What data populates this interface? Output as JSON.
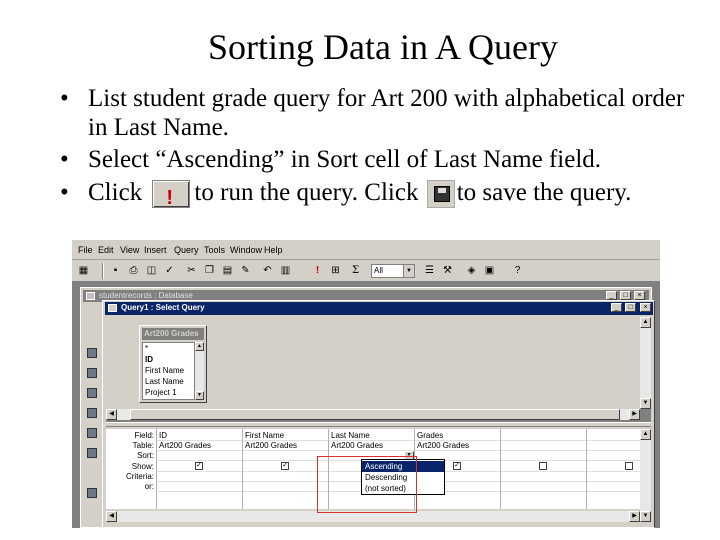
{
  "slide": {
    "title": "Sorting Data in A Query",
    "bullet1": "List student grade query for Art 200  with alphabetical order in Last Name.",
    "bullet2": "Select “Ascending” in Sort cell of Last Name field.",
    "bullet3_part1": "Click",
    "bullet3_part2": "to run the query.  Click",
    "bullet3_part3": "to save the query.",
    "run_icon_glyph": "!",
    "run_icon": "run-exclamation-icon",
    "save_icon": "floppy-disk-icon"
  },
  "menubar": {
    "items": [
      "File",
      "Edit",
      "View",
      "Insert",
      "Query",
      "Tools",
      "Window",
      "Help"
    ]
  },
  "toolbar": {
    "combo_value": "All",
    "run_glyph": "!",
    "totals_glyph": "Σ"
  },
  "db_window": {
    "title": "studentrecords : Database"
  },
  "query_window": {
    "title": "Query1 : Select Query",
    "min": "_",
    "max": "□",
    "close": "×"
  },
  "field_list": {
    "title": "Art200 Grades",
    "items": [
      "*",
      "ID",
      "First Name",
      "Last Name",
      "Project 1"
    ]
  },
  "design_grid": {
    "row_labels": [
      "Field:",
      "Table:",
      "Sort:",
      "Show:",
      "Criteria:",
      "or:"
    ],
    "columns": [
      {
        "field": "ID",
        "table": "Art200 Grades",
        "show": true
      },
      {
        "field": "First Name",
        "table": "Art200 Grades",
        "show": true
      },
      {
        "field": "Last Name",
        "table": "Art200 Grades",
        "show": true
      },
      {
        "field": "Grades",
        "table": "Art200 Grades",
        "show": true
      },
      {
        "field": "",
        "table": "",
        "show": false
      },
      {
        "field": "",
        "table": "",
        "show": false
      }
    ],
    "sort_options": [
      "Ascending",
      "Descending",
      "(not sorted)"
    ],
    "selected_sort": "Ascending",
    "check_glyph": "✓"
  },
  "colors": {
    "title_active": "#0a246a",
    "title_inactive": "#808080",
    "highlight": "#d83030",
    "run_red": "#cc0000"
  }
}
